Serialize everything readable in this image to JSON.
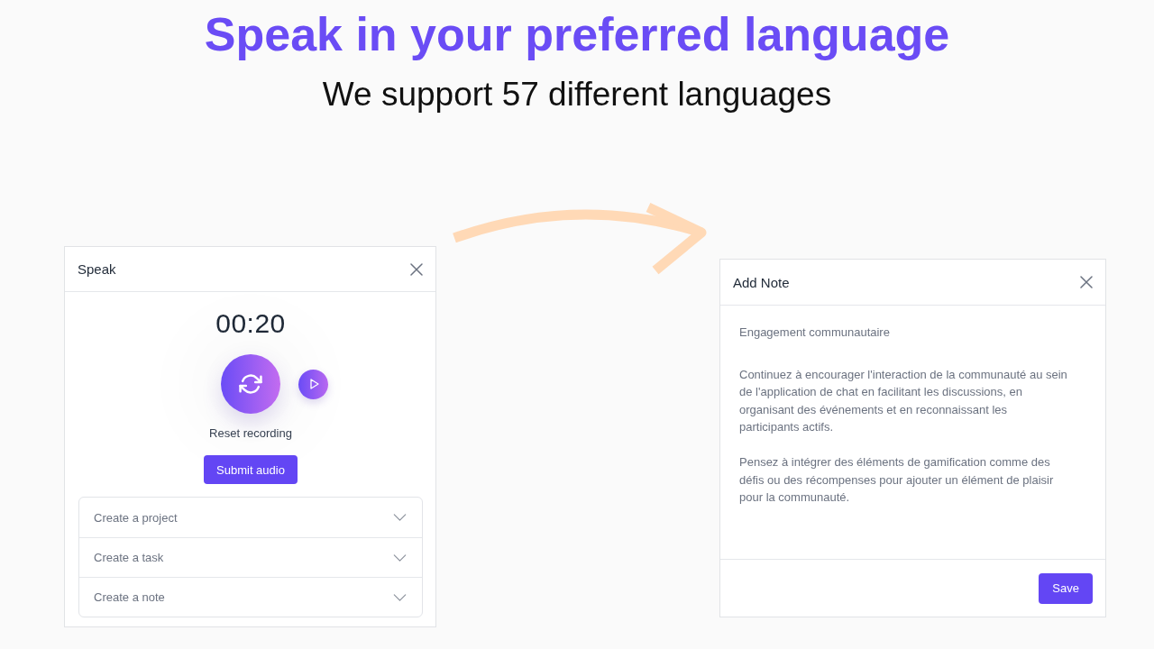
{
  "headline": {
    "title": "Speak in your preferred language",
    "subtitle": "We support 57 different languages"
  },
  "speak_dialog": {
    "title": "Speak",
    "timer": "00:20",
    "reset_label": "Reset recording",
    "submit_button": "Submit audio",
    "actions": [
      {
        "label": "Create a project",
        "expanded": false
      },
      {
        "label": "Create a task",
        "expanded": false
      },
      {
        "label": "Create a note",
        "expanded": false
      }
    ]
  },
  "note_dialog": {
    "title": "Add Note",
    "content": [
      {
        "kind": "heading",
        "text": "Engagement communautaire"
      },
      {
        "kind": "paragraph",
        "text": "Continuez à encourager l'interaction de la communauté au sein de l'application de chat en facilitant les discussions, en organisant des événements et en reconnaissant les participants actifs."
      },
      {
        "kind": "paragraph",
        "text": "Pensez à intégrer des éléments de gamification comme des défis ou des récompenses pour ajouter un élément de plaisir pour la communauté."
      }
    ],
    "save_button": "Save"
  }
}
